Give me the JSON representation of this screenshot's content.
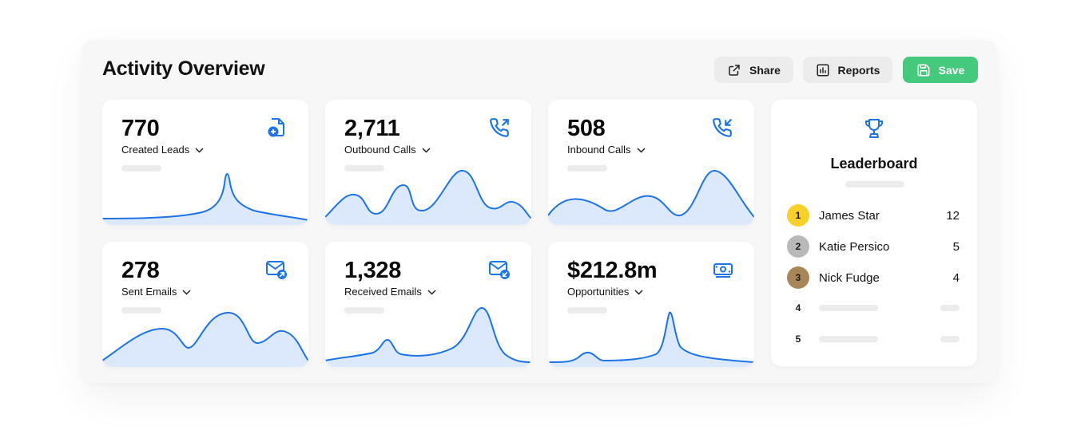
{
  "header": {
    "title": "Activity Overview",
    "share_label": "Share",
    "reports_label": "Reports",
    "save_label": "Save"
  },
  "colors": {
    "accent": "#1e73e8",
    "save_green": "#45c97c",
    "chart_fill": "#dce8fb",
    "gold": "#f7d02c",
    "silver": "#b9b9b9",
    "bronze": "#a98659"
  },
  "cards": [
    {
      "value": "770",
      "label": "Created Leads",
      "icon": "add-file-icon"
    },
    {
      "value": "2,711",
      "label": "Outbound Calls",
      "icon": "outbound-call-icon"
    },
    {
      "value": "508",
      "label": "Inbound Calls",
      "icon": "inbound-call-icon"
    },
    {
      "value": "278",
      "label": "Sent Emails",
      "icon": "sent-email-icon"
    },
    {
      "value": "1,328",
      "label": "Received Emails",
      "icon": "received-email-icon"
    },
    {
      "value": "$212.8m",
      "label": "Opportunities",
      "icon": "money-icon"
    }
  ],
  "leaderboard": {
    "title": "Leaderboard",
    "icon": "trophy-icon",
    "entries": [
      {
        "rank": "1",
        "name": "James Star",
        "score": "12"
      },
      {
        "rank": "2",
        "name": "Katie Persico",
        "score": "5"
      },
      {
        "rank": "3",
        "name": "Nick Fudge",
        "score": "4"
      },
      {
        "rank": "4"
      },
      {
        "rank": "5"
      }
    ]
  }
}
